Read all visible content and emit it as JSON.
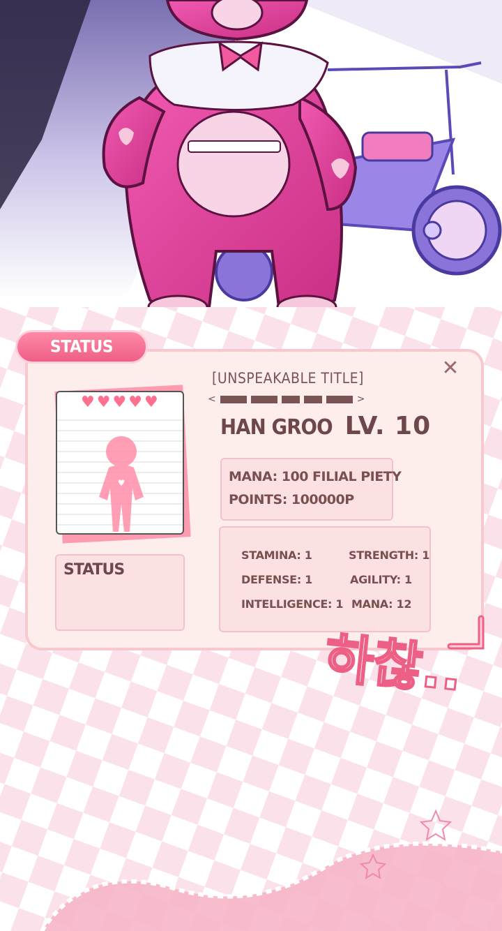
{
  "status_window": {
    "tab_label": "STATUS",
    "title": "[UNSPEAKABLE TITLE]",
    "character_name": "HAN GROO",
    "level": "LV. 10",
    "mana_line": "MANA: 100 FILIAL PIETY",
    "points_line": "POINTS: 100000P",
    "stats": {
      "stamina": "STAMINA: 1",
      "strength": "STRENGTH: 1",
      "defense": "DEFENSE: 1",
      "agility": "AGILITY: 1",
      "intelligence": "INTELLIGENCE: 1",
      "mana": "MANA: 12"
    },
    "status_box_label": "STATUS",
    "hearts": 5,
    "close_icon": "close-icon"
  },
  "sound_effect": "하찮..",
  "colors": {
    "accent_pink": "#ee5f86",
    "panel_bg": "#fdeeec",
    "text_brown": "#7a4f4f",
    "bear_magenta": "#e2459a"
  }
}
